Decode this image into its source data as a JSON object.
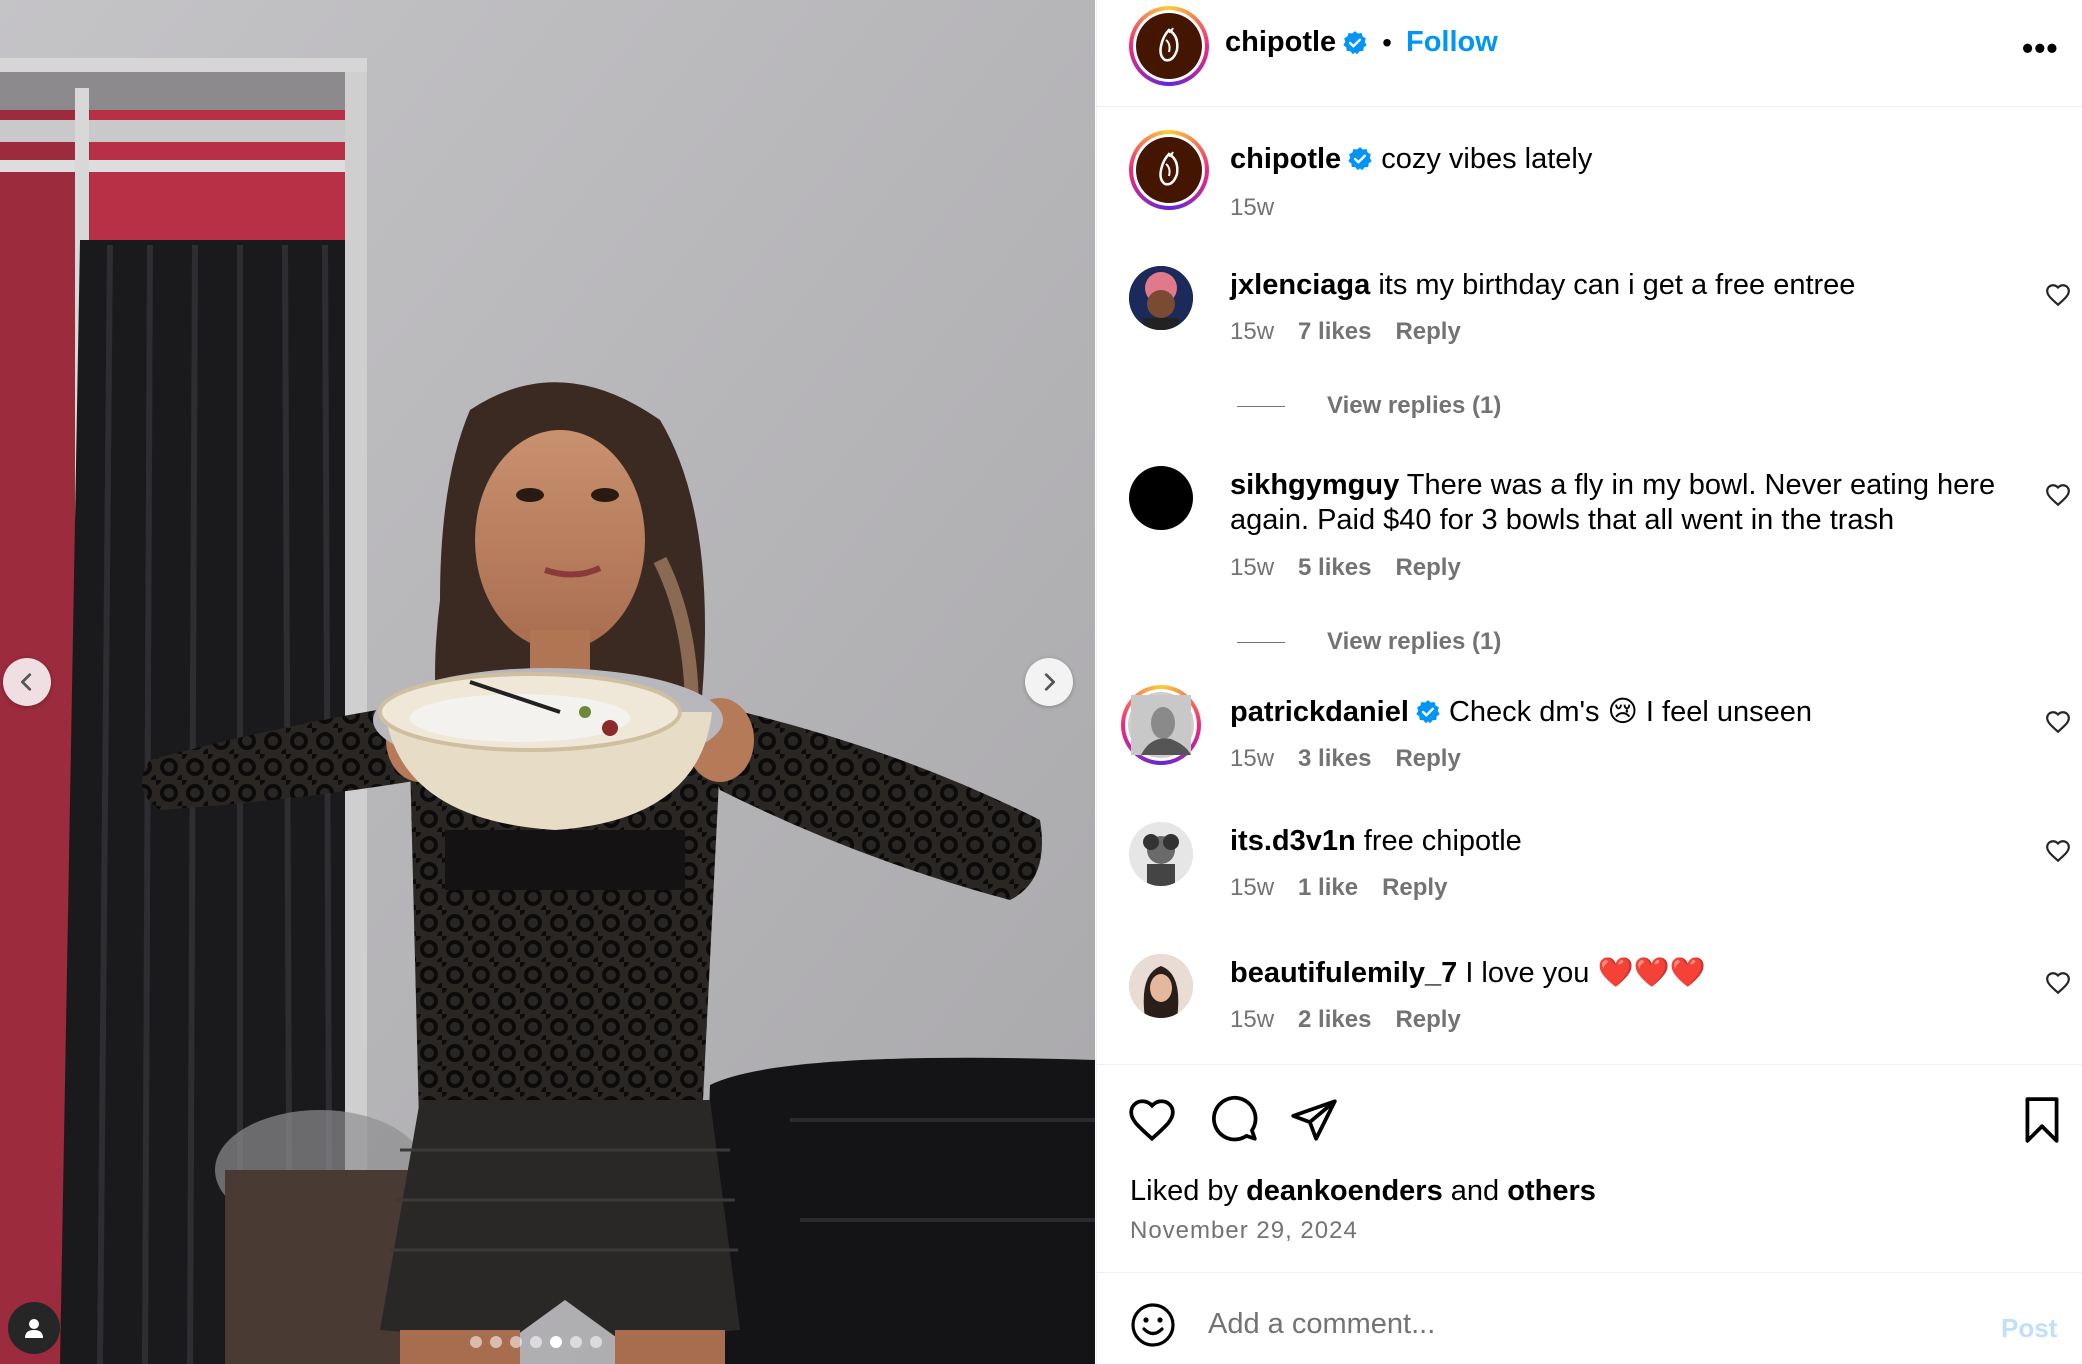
{
  "post": {
    "image_alt": "Woman in black lace top holding a Chipotle bowl",
    "carousel_count": 7,
    "carousel_active": 5,
    "prev_icon": "chevron-left-icon",
    "next_icon": "chevron-right-icon",
    "tag_icon": "person-icon"
  },
  "header": {
    "username": "chipotle",
    "separator": "•",
    "follow_label": "Follow",
    "more_label": "•••"
  },
  "caption": {
    "username": "chipotle",
    "text": "cozy vibes lately",
    "time": "15w"
  },
  "comments": [
    {
      "username": "jxlenciaga",
      "text": "its my birthday can i get a free entree",
      "time": "15w",
      "likes": "7 likes",
      "reply": "Reply",
      "view_replies": "View replies (1)"
    },
    {
      "username": "sikhgymguy",
      "text": "There was a fly in my bowl. Never eating here again. Paid $40 for 3 bowls that all went in the trash",
      "time": "15w",
      "likes": "5 likes",
      "reply": "Reply",
      "view_replies": "View replies (1)"
    },
    {
      "username": "patrickdaniel",
      "text": "Check dm's 😢 I feel unseen",
      "time": "15w",
      "likes": "3 likes",
      "reply": "Reply",
      "verified": true
    },
    {
      "username": "its.d3v1n",
      "text": "free chipotle",
      "time": "15w",
      "likes": "1 like",
      "reply": "Reply"
    },
    {
      "username": "beautifulemily_7",
      "text": "I love you ❤️❤️❤️",
      "time": "15w",
      "likes": "2 likes",
      "reply": "Reply"
    }
  ],
  "actions": {
    "liked_prefix": "Liked by",
    "liked_user": "deankoenders",
    "liked_and": "and",
    "liked_others": "others",
    "date": "November 29, 2024"
  },
  "composer": {
    "placeholder": "Add a comment...",
    "post_label": "Post"
  },
  "colors": {
    "accent": "#0095f6",
    "verified": "#0095f6",
    "brand": "#441500"
  }
}
